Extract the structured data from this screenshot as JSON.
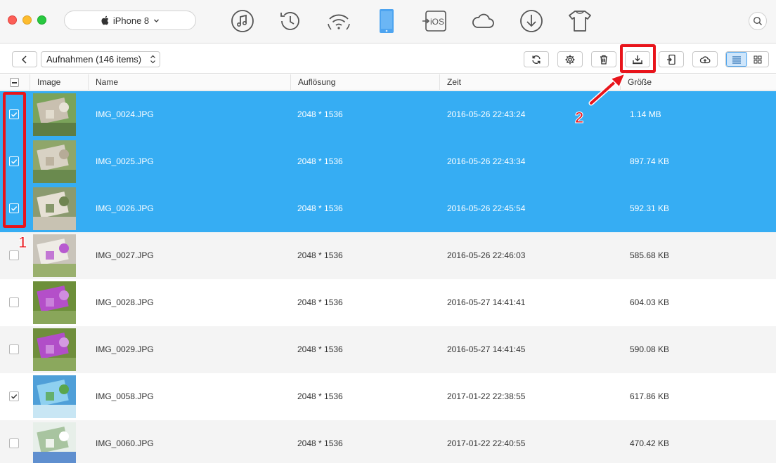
{
  "app": {
    "device_name": "iPhone 8",
    "top_icons": [
      {
        "name": "music-icon"
      },
      {
        "name": "history-icon"
      },
      {
        "name": "wifi-sync-icon"
      },
      {
        "name": "device-icon"
      },
      {
        "name": "to-ios-icon",
        "label": "iOS"
      },
      {
        "name": "cloud-icon"
      },
      {
        "name": "download-icon"
      },
      {
        "name": "tshirt-icon"
      }
    ]
  },
  "toolbar": {
    "album_label": "Aufnahmen (146 items)"
  },
  "columns": {
    "image": "Image",
    "name": "Name",
    "resolution": "Auflösung",
    "time": "Zeit",
    "size": "Größe"
  },
  "rows": [
    {
      "name": "IMG_0024.JPG",
      "resolution": "2048 * 1536",
      "time": "2016-05-26 22:43:24",
      "size": "1.14 MB",
      "selected": true,
      "checked": true
    },
    {
      "name": "IMG_0025.JPG",
      "resolution": "2048 * 1536",
      "time": "2016-05-26 22:43:34",
      "size": "897.74 KB",
      "selected": true,
      "checked": true
    },
    {
      "name": "IMG_0026.JPG",
      "resolution": "2048 * 1536",
      "time": "2016-05-26 22:45:54",
      "size": "592.31 KB",
      "selected": true,
      "checked": true
    },
    {
      "name": "IMG_0027.JPG",
      "resolution": "2048 * 1536",
      "time": "2016-05-26 22:46:03",
      "size": "585.68 KB",
      "selected": false,
      "checked": false
    },
    {
      "name": "IMG_0028.JPG",
      "resolution": "2048 * 1536",
      "time": "2016-05-27 14:41:41",
      "size": "604.03 KB",
      "selected": false,
      "checked": false
    },
    {
      "name": "IMG_0029.JPG",
      "resolution": "2048 * 1536",
      "time": "2016-05-27 14:41:45",
      "size": "590.08 KB",
      "selected": false,
      "checked": false
    },
    {
      "name": "IMG_0058.JPG",
      "resolution": "2048 * 1536",
      "time": "2017-01-22 22:38:55",
      "size": "617.86 KB",
      "selected": false,
      "checked": true
    },
    {
      "name": "IMG_0060.JPG",
      "resolution": "2048 * 1536",
      "time": "2017-01-22 22:40:55",
      "size": "470.42 KB",
      "selected": false,
      "checked": false
    }
  ],
  "annotations": {
    "step1": "1",
    "step2": "2"
  },
  "colors": {
    "selection": "#36adf3",
    "accent_red": "#e8141b"
  }
}
